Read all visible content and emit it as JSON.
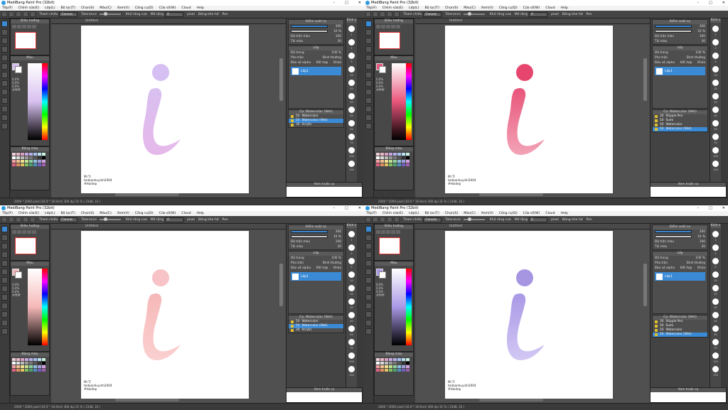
{
  "app": {
    "title": "MediBang Paint Pro (32bit)",
    "menu": [
      "Tệp(F)",
      "Chỉnh sửa(E)",
      "Lớp(L)",
      "Bộ lọc(T)",
      "Chọn(S)",
      "Màu(C)",
      "Xem(V)",
      "Công cụ(D)",
      "Cửa sổ(W)",
      "Cloud",
      "Help"
    ],
    "toolbar": {
      "reference_label": "Tham chiếu",
      "reference_value": "Canvas",
      "tolerance_label": "Tolerance",
      "antialias_label": "Khử răng cưa",
      "expand_label": "Mở rộng",
      "expand_value": "0",
      "expand_unit": "pixel",
      "fill_opaque_label": "Đóng khe hở",
      "mode_label": "Pen",
      "stabilizer_label": "Điều khiển"
    },
    "doc_tab": "Untitled",
    "panels": {
      "navigator": "Điều hướng",
      "color": "Màu",
      "palette": "Bảng màu",
      "brush_control": "Kiểm soát cọ",
      "layer": "Lớp",
      "brush": "Cọ: Watercolor (Wet)",
      "preview": "Xem trước cọ",
      "size_col": "Kích c"
    },
    "brush_control": {
      "size": "300",
      "opacity": "10 %",
      "blend_label": "Độ trộn màu",
      "blend_value": "100",
      "dilution_label": "Tải màu",
      "dilution_value": "30"
    },
    "layer": {
      "opacity_label": "Độ trong",
      "opacity_value": "100 %",
      "blend_label": "Pha trộn",
      "blend_value": "Bình thường",
      "protect_label": "Bảo vệ alpha",
      "clip_label": "Kết hợp",
      "lock_label": "Khóa",
      "layer_name": "Lớp1"
    },
    "brushes": [
      {
        "size": "50",
        "name": "Watercolor"
      },
      {
        "size": "50",
        "name": "Watercolor (Wet)"
      },
      {
        "size": "30",
        "name": "Acrylic"
      }
    ],
    "brushes_alt": [
      {
        "size": "30",
        "name": "Stipple Pen"
      },
      {
        "size": "50",
        "name": "Sumi"
      },
      {
        "size": "50",
        "name": "Watercolor"
      },
      {
        "size": "50",
        "name": "Watercolor (Wet)"
      }
    ],
    "brush_sizes": [
      "1",
      "2",
      "5",
      "10",
      "20",
      "30",
      "40",
      "50",
      "70",
      "100",
      "150",
      "200",
      "300"
    ],
    "color_info": [
      "0,0%",
      "0,0%",
      "0,0%",
      "#ffffff"
    ],
    "signature": [
      "Mi Ti",
      "tedoanhuyinh2004",
      "#Hoidep"
    ],
    "status": "2000 * 2000 pixel  (16.9 * 16.9cm)  300 dpi  31 %  ( 2348, 33 )",
    "preview_number": "30.7"
  },
  "quadrants": [
    {
      "name": "quadrant-top-left",
      "i_color": "#d8c0f0",
      "i_color2": "#e6b8ea",
      "dot": "#d6bff2"
    },
    {
      "name": "quadrant-top-right",
      "i_color": "#e8557a",
      "i_color2": "#f3a3b6",
      "dot": "#e6466e"
    },
    {
      "name": "quadrant-bottom-left",
      "i_color": "#f6b8b8",
      "i_color2": "#fbd0d0",
      "dot": "#f7c3c6"
    },
    {
      "name": "quadrant-bottom-right",
      "i_color": "#a998e6",
      "i_color2": "#d2c8f4",
      "dot": "#a696e2"
    }
  ]
}
